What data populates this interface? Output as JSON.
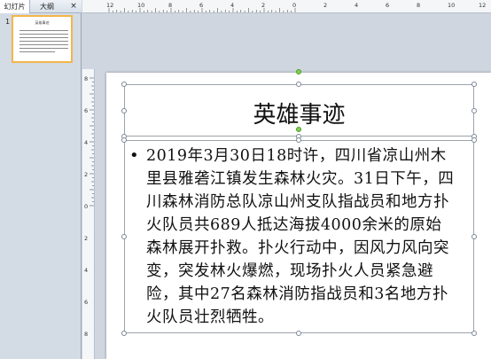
{
  "left_panel": {
    "tabs": [
      "幻灯片",
      "大纲"
    ],
    "close_label": "×",
    "thumbnail_index": "1"
  },
  "slide": {
    "title": "英雄事迹",
    "bullet": "•",
    "body": "2019年3月30日18时许，四川省凉山州木里县雅砻江镇发生森林火灾。31日下午，四川森林消防总队凉山州支队指战员和地方扑火队员共689人抵达海拔4000余米的原始森林展开扑救。扑火行动中，因风力风向突变，突发林火爆燃，现场扑火人员紧急避险，其中27名森林消防指战员和3名地方扑火队员壮烈牺牲。"
  },
  "rulers": {
    "top_labels": [
      "12",
      "10",
      "8",
      "6",
      "4",
      "2",
      "0",
      "2",
      "4",
      "6",
      "8",
      "10",
      "12"
    ],
    "left_labels": [
      "8",
      "6",
      "4",
      "2",
      "0",
      "2",
      "4",
      "6",
      "8"
    ]
  },
  "colors": {
    "thumbnail_border": "#f3b64a",
    "rotation_handle": "#7bd34b"
  }
}
